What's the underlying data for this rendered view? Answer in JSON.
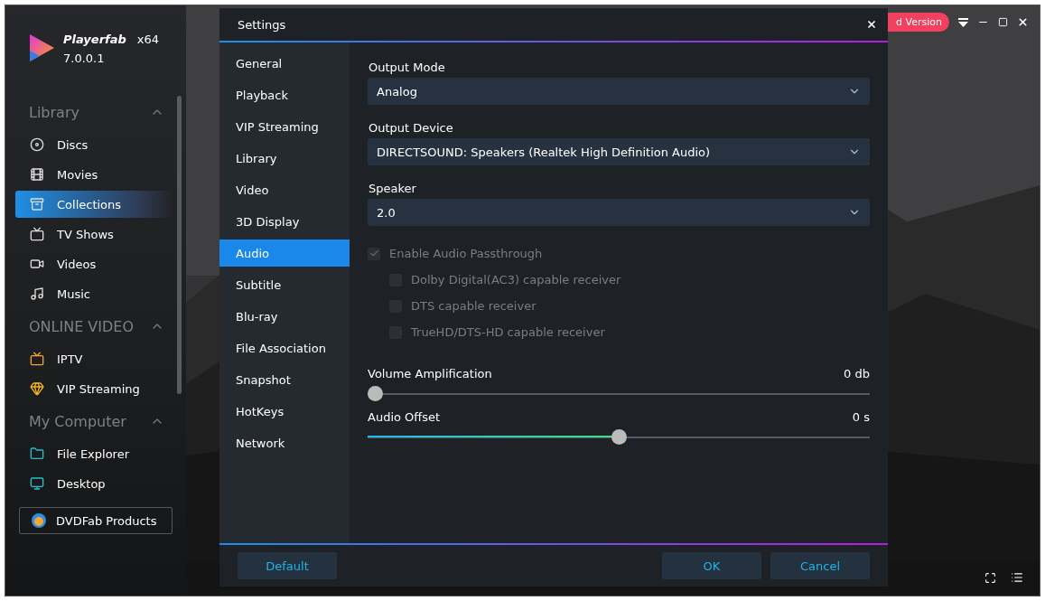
{
  "app": {
    "name": "Playerfab",
    "arch": "x64",
    "version": "7.0.0.1"
  },
  "sidebar": {
    "sections": [
      {
        "title": "Library",
        "expanded": true,
        "items": [
          {
            "label": "Discs",
            "kind": "disc",
            "selected": false
          },
          {
            "label": "Movies",
            "kind": "film",
            "selected": false
          },
          {
            "label": "Collections",
            "kind": "box",
            "selected": true
          },
          {
            "label": "TV Shows",
            "kind": "tv",
            "selected": false
          },
          {
            "label": "Videos",
            "kind": "video",
            "selected": false
          },
          {
            "label": "Music",
            "kind": "music",
            "selected": false
          }
        ]
      },
      {
        "title": "ONLINE VIDEO",
        "expanded": true,
        "items": [
          {
            "label": "IPTV",
            "kind": "iptv",
            "selected": false
          },
          {
            "label": "VIP Streaming",
            "kind": "vip",
            "selected": false
          }
        ]
      },
      {
        "title": "My Computer",
        "expanded": true,
        "items": [
          {
            "label": "File Explorer",
            "kind": "explorer",
            "selected": false
          },
          {
            "label": "Desktop",
            "kind": "desktop",
            "selected": false
          }
        ]
      }
    ],
    "products_button": "DVDFab Products"
  },
  "header": {
    "upgrade_badge": "d Version"
  },
  "settings": {
    "title": "Settings",
    "nav": [
      {
        "label": "General",
        "selected": false
      },
      {
        "label": "Playback",
        "selected": false
      },
      {
        "label": "VIP Streaming",
        "selected": false
      },
      {
        "label": "Library",
        "selected": false
      },
      {
        "label": "Video",
        "selected": false
      },
      {
        "label": "3D Display",
        "selected": false
      },
      {
        "label": "Audio",
        "selected": true
      },
      {
        "label": "Subtitle",
        "selected": false
      },
      {
        "label": "Blu-ray",
        "selected": false
      },
      {
        "label": "File Association",
        "selected": false
      },
      {
        "label": "Snapshot",
        "selected": false
      },
      {
        "label": "HotKeys",
        "selected": false
      },
      {
        "label": "Network",
        "selected": false
      }
    ],
    "selects": [
      {
        "label": "Output Mode",
        "value": "Analog"
      },
      {
        "label": "Output Device",
        "value": "DIRECTSOUND: Speakers (Realtek High Definition Audio)"
      },
      {
        "label": "Speaker",
        "value": "2.0"
      }
    ],
    "checkboxes": [
      {
        "label": "Enable Audio Passthrough",
        "checked": true,
        "disabled": true,
        "children": [
          {
            "label": "Dolby Digital(AC3) capable receiver",
            "checked": false,
            "disabled": true
          },
          {
            "label": "DTS capable receiver",
            "checked": false,
            "disabled": true
          },
          {
            "label": "TrueHD/DTS-HD capable receiver",
            "checked": false,
            "disabled": true
          }
        ]
      }
    ],
    "sliders": [
      {
        "label": "Volume Amplification",
        "reading": "0 db",
        "level": 0
      },
      {
        "label": "Audio Offset",
        "reading": "0 s",
        "level": 0.5
      }
    ],
    "buttons": [
      {
        "label": "Default",
        "kind": "left"
      },
      {
        "label": "OK",
        "kind": "right"
      },
      {
        "label": "Cancel",
        "kind": "right"
      }
    ]
  }
}
